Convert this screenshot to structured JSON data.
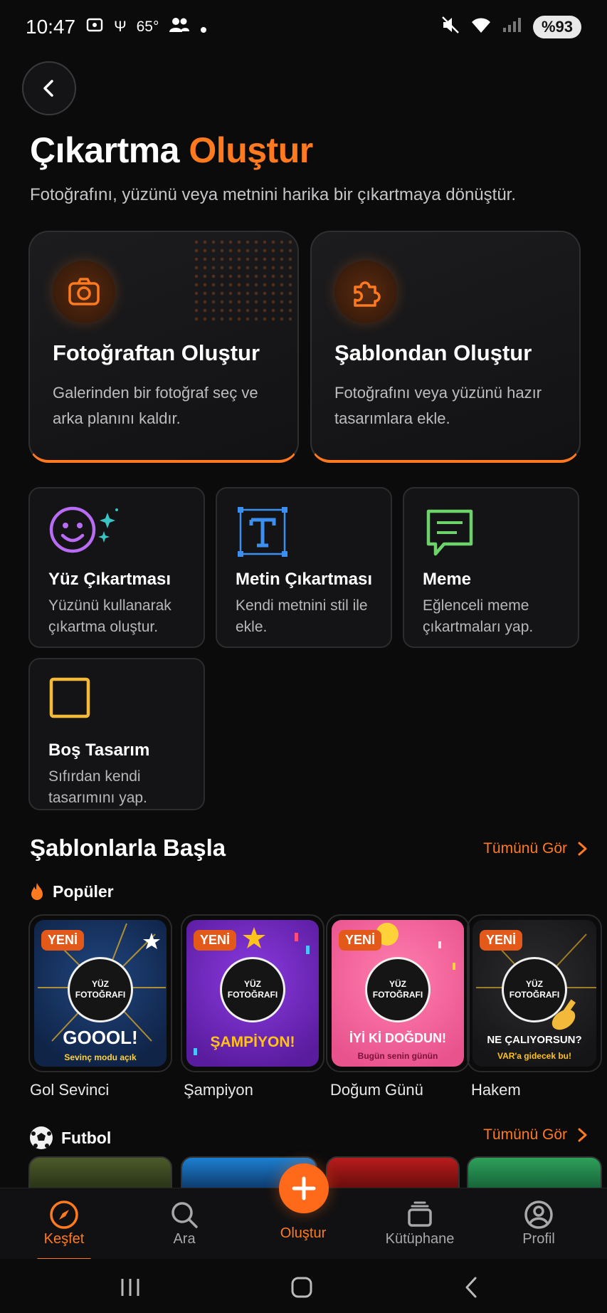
{
  "status_bar": {
    "time": "10:47",
    "temperature": "65°",
    "battery": "%93",
    "icons": [
      "screenshot-icon",
      "usb-icon",
      "people-icon",
      "dot-icon",
      "mute-icon",
      "wifi-icon",
      "signal-icon"
    ]
  },
  "header": {
    "title_main": "Çıkartma",
    "title_accent": "Oluştur",
    "subtitle": "Fotoğrafını, yüzünü veya metnini harika bir çıkartmaya dönüştür."
  },
  "big_cards": [
    {
      "title": "Fotoğraftan Oluştur",
      "desc": "Galerinden bir fotoğraf seç ve arka planını kaldır.",
      "icon": "camera-icon"
    },
    {
      "title": "Şablondan Oluştur",
      "desc": "Fotoğrafını veya yüzünü hazır tasarımlara ekle.",
      "icon": "puzzle-icon"
    }
  ],
  "small_cards": [
    {
      "title": "Yüz Çıkartması",
      "desc": "Yüzünü kullanarak çıkartma oluştur.",
      "icon": "smiley-icon"
    },
    {
      "title": "Metin Çıkartması",
      "desc": "Kendi metnini stil ile ekle.",
      "icon": "text-icon"
    },
    {
      "title": "Meme",
      "desc": "Eğlenceli meme çıkartmaları yap.",
      "icon": "chat-icon"
    },
    {
      "title": "Boş Tasarım",
      "desc": "Sıfırdan kendi tasarımını yap.",
      "icon": "square-icon"
    }
  ],
  "templates_section": {
    "title": "Şablonlarla Başla",
    "see_all": "Tümünü Gör",
    "popular_label": "Popüler",
    "football_label": "Futbol",
    "badge": "YENİ",
    "face_text": "YÜZ FOTOĞRAFI",
    "items": [
      {
        "label": "Gol Sevinci",
        "big": "GOOOL!",
        "small": "Sevinç modu açık",
        "bg": "#16315f",
        "big_color": "#ffffff",
        "small_color": "#ffd23a"
      },
      {
        "label": "Şampiyon",
        "big": "ŞAMPİYON!",
        "small": "",
        "bg": "#6a24b8",
        "big_color": "#ffc21a",
        "small_color": "#ffffff"
      },
      {
        "label": "Doğum Günü",
        "big": "İYİ Kİ DOĞDUN!",
        "small": "Bugün senin günün",
        "bg": "#f0629a",
        "big_color": "#ffffff",
        "small_color": "#7a1238"
      },
      {
        "label": "Hakem",
        "big": "NE ÇALIYORSUN?",
        "small": "VAR'a gidecek bu!",
        "bg": "#1e1e20",
        "big_color": "#ffffff",
        "small_color": "#ffc21a"
      }
    ]
  },
  "bottom_nav": {
    "items": [
      {
        "label": "Keşfet",
        "icon": "compass-icon"
      },
      {
        "label": "Ara",
        "icon": "search-icon"
      },
      {
        "label": "Oluştur",
        "icon": "plus-icon"
      },
      {
        "label": "Kütüphane",
        "icon": "library-icon"
      },
      {
        "label": "Profil",
        "icon": "profile-icon"
      }
    ]
  },
  "colors": {
    "accent": "#ff7a1f",
    "background": "#0b0b0c"
  }
}
